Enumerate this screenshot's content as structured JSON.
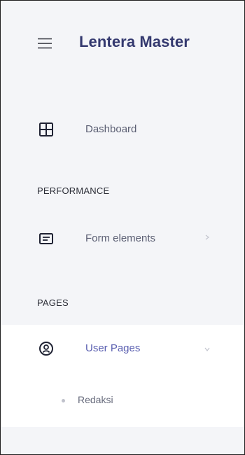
{
  "app": {
    "title": "Lentera Master"
  },
  "icons": {
    "menu": "hamburger-menu-icon",
    "dashboard": "grid-icon",
    "form": "form-list-icon",
    "user": "user-circle-icon",
    "arrow_right": "chevron-right-icon",
    "arrow_down": "chevron-down-icon"
  },
  "sidebar": {
    "dashboard_label": "Dashboard",
    "sections": [
      {
        "title": "PERFORMANCE",
        "items": [
          {
            "label": "Form elements",
            "has_chevron": "right"
          }
        ]
      },
      {
        "title": "PAGES",
        "items": [
          {
            "label": "User Pages",
            "has_chevron": "down",
            "expanded": true,
            "children": [
              {
                "label": "Redaksi"
              }
            ]
          }
        ]
      }
    ]
  },
  "colors": {
    "brand": "#34396f",
    "sidebar_bg": "#f4f5f8",
    "active_panel_bg": "#ffffff",
    "text_muted": "#5b5f73",
    "section_text": "#2d2f38"
  }
}
